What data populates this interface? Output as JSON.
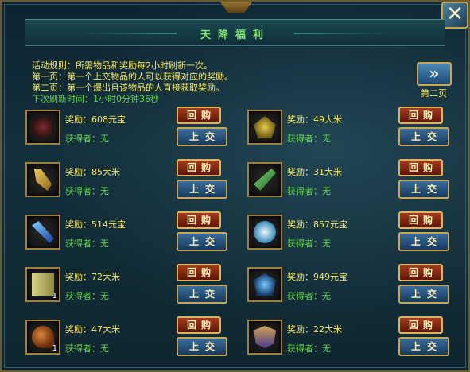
{
  "window": {
    "title": "天降福利",
    "close_label": "✕"
  },
  "rules": {
    "line1": "活动规则：所需物品和奖励每2小时刷新一次。",
    "line2": "第一页：第一个上交物品的人可以获得对应的奖励。",
    "line3": "第二页：第一个爆出且该物品的人直接获取奖励。",
    "timer": "下次刷新时间：1小时0分钟36秒"
  },
  "pager": {
    "next_icon": "»",
    "next_label": "第二页"
  },
  "buttons": {
    "buyback": "回购",
    "submit": "上交"
  },
  "items": [
    {
      "icon": "dark-beast-armor-icon",
      "reward": "奖励：608元宝",
      "winner": "获得者：无",
      "qty": ""
    },
    {
      "icon": "golden-dragon-icon",
      "reward": "奖励：49大米",
      "winner": "获得者：无",
      "qty": ""
    },
    {
      "icon": "golden-claw-weapon-icon",
      "reward": "奖励：85大米",
      "winner": "获得者：无",
      "qty": ""
    },
    {
      "icon": "green-dagger-icon",
      "reward": "奖励：31大米",
      "winner": "获得者：无",
      "qty": ""
    },
    {
      "icon": "blue-crystal-blade-icon",
      "reward": "奖励：514元宝",
      "winner": "获得者：无",
      "qty": ""
    },
    {
      "icon": "ice-spirit-icon",
      "reward": "奖励：857元宝",
      "winner": "获得者：无",
      "qty": ""
    },
    {
      "icon": "scroll-book-icon",
      "reward": "奖励：72大米",
      "winner": "获得者：无",
      "qty": "1"
    },
    {
      "icon": "blue-armor-icon",
      "reward": "奖励：949元宝",
      "winner": "获得者：无",
      "qty": ""
    },
    {
      "icon": "roast-leg-icon",
      "reward": "奖励：47大米",
      "winner": "获得者：无",
      "qty": "1"
    },
    {
      "icon": "ornate-shield-icon",
      "reward": "奖励：22大米",
      "winner": "获得者：无",
      "qty": ""
    }
  ],
  "colors": {
    "reward_text": "#f5e35e",
    "winner_text": "#62d24a",
    "title_text": "#7fe26a",
    "frame_gold": "#c7a756"
  }
}
